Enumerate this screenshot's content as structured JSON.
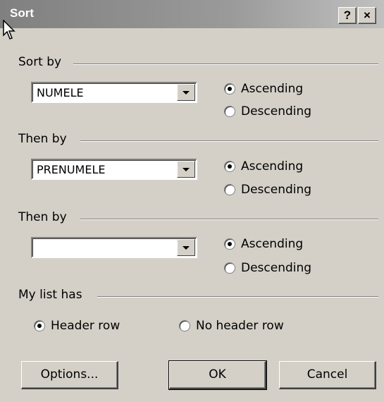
{
  "window": {
    "title": "Sort",
    "help_button": "?",
    "close_button": "×"
  },
  "groups": [
    {
      "label": "Sort by",
      "field": "NUMELE",
      "ascending": "Ascending",
      "descending": "Descending",
      "selected": "ascending"
    },
    {
      "label": "Then by",
      "field": "PRENUMELE",
      "ascending": "Ascending",
      "descending": "Descending",
      "selected": "ascending"
    },
    {
      "label": "Then by",
      "field": "",
      "ascending": "Ascending",
      "descending": "Descending",
      "selected": "ascending"
    }
  ],
  "list_has": {
    "label": "My list has",
    "header_row": "Header row",
    "no_header_row": "No header row",
    "selected": "header_row"
  },
  "buttons": {
    "options": "Options...",
    "ok": "OK",
    "cancel": "Cancel"
  },
  "colors": {
    "dialog_bg": "#d4d0c8",
    "titlebar_inactive": "#808080"
  }
}
